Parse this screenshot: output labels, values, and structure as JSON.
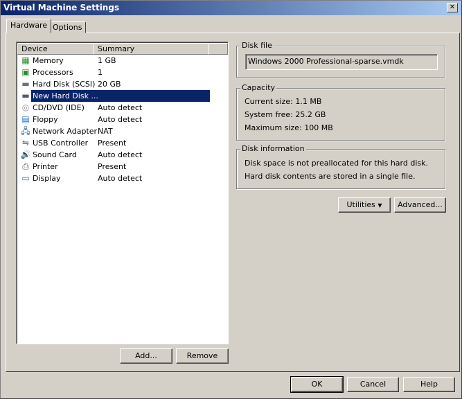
{
  "window": {
    "title": "Virtual Machine Settings",
    "close": "✕"
  },
  "tabs": [
    {
      "label": "Hardware"
    },
    {
      "label": "Options"
    }
  ],
  "device_list": {
    "columns": [
      "Device",
      "Summary"
    ],
    "rows": [
      {
        "device": "Memory",
        "summary": "1 GB",
        "icon": "memory-icon",
        "glyph": "▦",
        "color": "#2a8a2a"
      },
      {
        "device": "Processors",
        "summary": "1",
        "icon": "processor-icon",
        "glyph": "▣",
        "color": "#2a8a2a"
      },
      {
        "device": "Hard Disk (SCSI)",
        "summary": "20 GB",
        "icon": "hard-disk-icon",
        "glyph": "▬",
        "color": "#707070"
      },
      {
        "device": "New Hard Disk ...",
        "summary": "",
        "icon": "hard-disk-icon",
        "glyph": "▬",
        "color": "#505a70"
      },
      {
        "device": "CD/DVD (IDE)",
        "summary": "Auto detect",
        "icon": "cd-icon",
        "glyph": "◎",
        "color": "#909090"
      },
      {
        "device": "Floppy",
        "summary": "Auto detect",
        "icon": "floppy-icon",
        "glyph": "▤",
        "color": "#1e6fd0"
      },
      {
        "device": "Network Adapter",
        "summary": "NAT",
        "icon": "network-icon",
        "glyph": "🖧",
        "color": "#1e5fa0"
      },
      {
        "device": "USB Controller",
        "summary": "Present",
        "icon": "usb-icon",
        "glyph": "⇋",
        "color": "#4a5a70"
      },
      {
        "device": "Sound Card",
        "summary": "Auto detect",
        "icon": "speaker-icon",
        "glyph": "🔊",
        "color": "#3060a0"
      },
      {
        "device": "Printer",
        "summary": "Present",
        "icon": "printer-icon",
        "glyph": "⎙",
        "color": "#606060"
      },
      {
        "device": "Display",
        "summary": "Auto detect",
        "icon": "display-icon",
        "glyph": "▭",
        "color": "#3a6ea5"
      }
    ],
    "selected_index": 3
  },
  "list_buttons": {
    "add": "Add...",
    "remove": "Remove"
  },
  "disk_file": {
    "legend": "Disk file",
    "value": "Windows 2000 Professional-sparse.vmdk"
  },
  "capacity": {
    "legend": "Capacity",
    "current": "Current size:  1.1 MB",
    "free": "System free:  25.2 GB",
    "max": "Maximum size:  100 MB"
  },
  "disk_info": {
    "legend": "Disk information",
    "line1": "Disk space is not preallocated for this hard disk.",
    "line2": "Hard disk contents are stored in a single file."
  },
  "disk_buttons": {
    "utilities": "Utilities",
    "advanced": "Advanced..."
  },
  "footer": {
    "ok": "OK",
    "cancel": "Cancel",
    "help": "Help"
  }
}
